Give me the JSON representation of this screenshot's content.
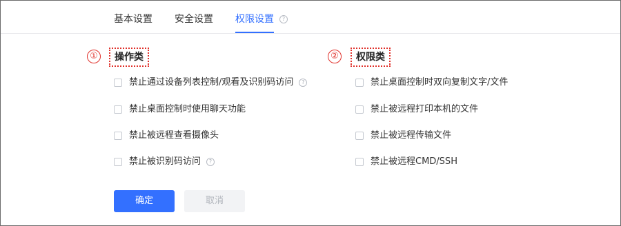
{
  "tabs": [
    {
      "label": "基本设置",
      "active": false
    },
    {
      "label": "安全设置",
      "active": false
    },
    {
      "label": "权限设置",
      "active": true
    }
  ],
  "tab_help_icon": "question-circle-icon",
  "annotations": {
    "marker_1": "①",
    "marker_2": "②"
  },
  "sections": {
    "operation": {
      "title": "操作类",
      "items": [
        {
          "label": "禁止通过设备列表控制/观看及识别码访问",
          "checked": false,
          "has_help": true
        },
        {
          "label": "禁止桌面控制时使用聊天功能",
          "checked": false,
          "has_help": false
        },
        {
          "label": "禁止被远程查看摄像头",
          "checked": false,
          "has_help": false
        },
        {
          "label": "禁止被识别码访问",
          "checked": false,
          "has_help": true
        }
      ]
    },
    "permission": {
      "title": "权限类",
      "items": [
        {
          "label": "禁止桌面控制时双向复制文字/文件",
          "checked": false
        },
        {
          "label": "禁止被远程打印本机的文件",
          "checked": false
        },
        {
          "label": "禁止被远程传输文件",
          "checked": false
        },
        {
          "label": "禁止被远程CMD/SSH",
          "checked": false
        }
      ]
    }
  },
  "buttons": {
    "confirm": "确定",
    "cancel": "取消"
  },
  "colors": {
    "accent": "#3370ff",
    "annotation": "#e0302a",
    "disabled_bg": "#f2f3f5"
  }
}
